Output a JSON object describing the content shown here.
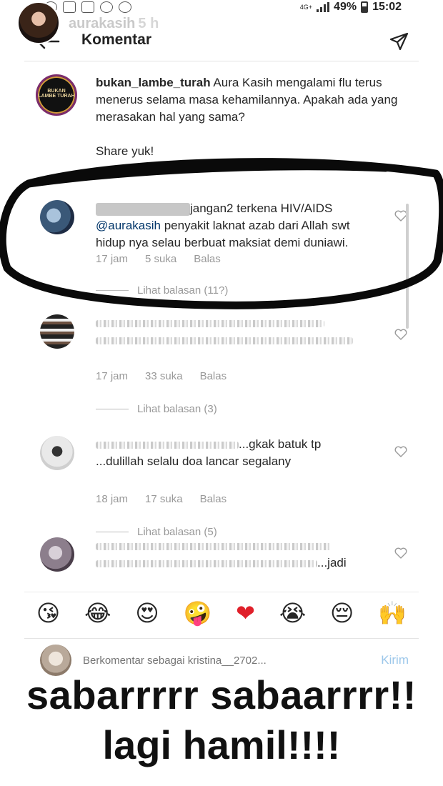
{
  "status_bar": {
    "network": "4G+",
    "battery": "49%",
    "time": "15:02"
  },
  "story": {
    "username": "aurakasih",
    "time": "5 h",
    "overlay_line1": "sabarrrrr sabaarrrr!!",
    "overlay_line2": "lagi hamil!!!!"
  },
  "header": {
    "title": "Komentar"
  },
  "caption": {
    "username": "bukan_lambe_turah",
    "text": "Aura Kasih mengalami flu terus menerus selama masa kehamilannya. Apakah ada yang merasakan hal yang sama?",
    "share": "Share yuk!",
    "avatar_logo": "BUKAN LAMBE TURAH"
  },
  "comments": [
    {
      "text_line1": "jangan2 terkena HIV/AIDS",
      "mention": "@aurakasih",
      "text_rest": "penyakit laknat azab dari Allah swt hidup nya selau berbuat maksiat demi duniawi.",
      "time": "17 jam",
      "likes": "5 suka",
      "reply": "Balas",
      "view_replies": "Lihat balasan (11?)"
    },
    {
      "text_line1": "",
      "time": "17 jam",
      "likes": "33 suka",
      "reply": "Balas",
      "view_replies": "Lihat balasan (3)"
    },
    {
      "text_line1": "...gkak batuk tp",
      "text_line2": "...dulillah selalu doa lancar segalany",
      "time": "18 jam",
      "likes": "17 suka",
      "reply": "Balas",
      "view_replies": "Lihat balasan (5)"
    },
    {
      "text_line1": "...jadi",
      "time": "",
      "likes": "",
      "reply": ""
    }
  ],
  "emojis": [
    "😘",
    "😂",
    "😍",
    "🤪",
    "❤",
    "😭",
    "😔",
    "🙌"
  ],
  "composer": {
    "placeholder": "Berkomentar sebagai kristina__2702...",
    "send_label": "Kirim"
  },
  "colors": {
    "mention": "#003569",
    "meta": "#999999",
    "send": "#9cc7ea"
  }
}
